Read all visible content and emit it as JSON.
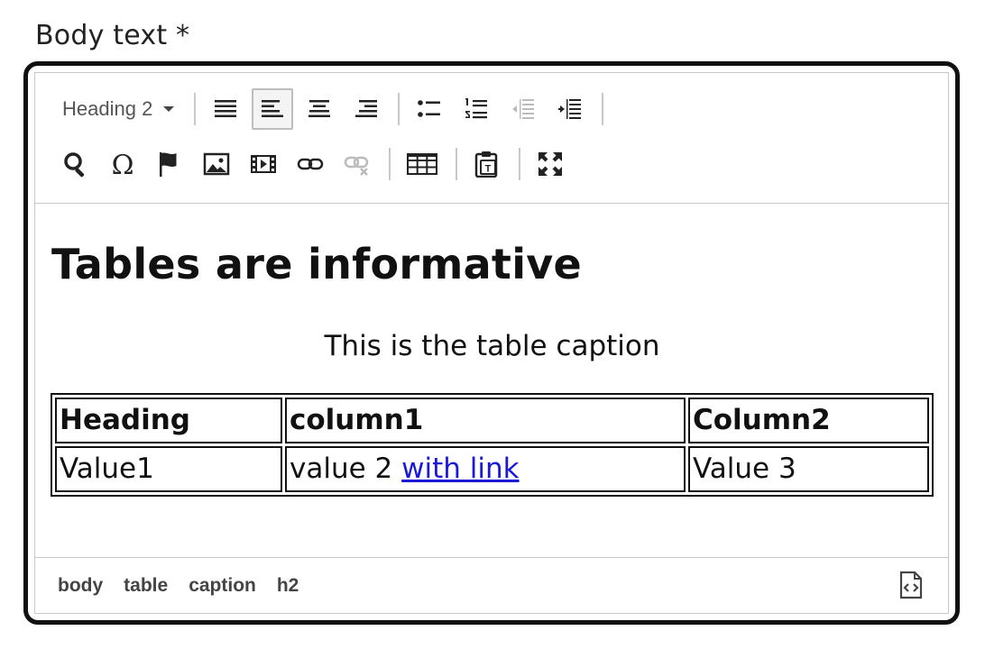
{
  "field": {
    "label": "Body text *"
  },
  "toolbar": {
    "format_select": "Heading 2",
    "row1": [
      {
        "icon": "align-justify-icon"
      },
      {
        "icon": "align-left-icon",
        "active": true
      },
      {
        "icon": "align-center-icon"
      },
      {
        "icon": "align-right-icon"
      },
      {
        "icon": "bullet-list-icon"
      },
      {
        "icon": "numbered-list-icon"
      },
      {
        "icon": "outdent-icon",
        "disabled": true
      },
      {
        "icon": "indent-icon"
      }
    ],
    "row2": [
      {
        "icon": "search-replace-icon"
      },
      {
        "icon": "special-character-icon"
      },
      {
        "icon": "anchor-flag-icon"
      },
      {
        "icon": "insert-image-icon"
      },
      {
        "icon": "insert-media-icon"
      },
      {
        "icon": "insert-link-icon"
      },
      {
        "icon": "remove-link-icon",
        "disabled": true
      },
      {
        "icon": "insert-table-icon"
      },
      {
        "icon": "paste-as-text-icon"
      },
      {
        "icon": "fullscreen-icon"
      }
    ]
  },
  "content": {
    "heading": "Tables are informative",
    "table": {
      "caption": "This is the table caption",
      "headers": [
        "Heading",
        "column1",
        "Column2"
      ],
      "row": {
        "col1": "Value1",
        "col2_text": "value 2 ",
        "col2_link": "with link",
        "col3": "Value 3"
      }
    }
  },
  "statusbar": {
    "path": [
      "body",
      "table",
      "caption",
      "h2"
    ],
    "source_icon": "source-code-icon"
  },
  "colors": {
    "border": "#111111",
    "link": "#1a1ad6",
    "divider": "#c8c8c8"
  }
}
